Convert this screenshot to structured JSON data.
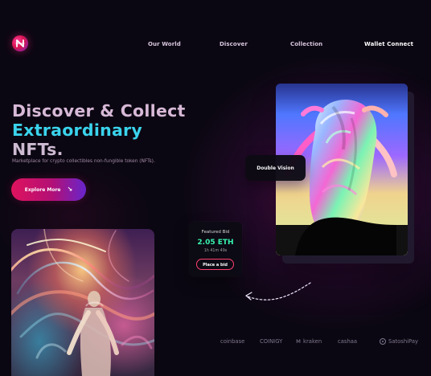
{
  "brand": {
    "logo_icon": "brand-logo-icon"
  },
  "nav": {
    "items": [
      {
        "label": "Our World"
      },
      {
        "label": "Discover"
      },
      {
        "label": "Collection"
      },
      {
        "label": "Wallet Connect"
      }
    ]
  },
  "hero": {
    "title_line_1": "Discover & Collect",
    "title_line_2": "Extraordinary",
    "title_line_3": "NFTs.",
    "subtitle": "Marketplace for crypto collectibles non-fungible token (NFTs).",
    "cta_label": "Explore More",
    "cta_icon": "arrow-down-right-icon"
  },
  "featured": {
    "label": "Featured Bid",
    "price": "2.05 ETH",
    "timer": "1h 41m 49s",
    "button_label": "Place a bid"
  },
  "artwork": {
    "right_card_label": "Double Vision"
  },
  "partners": {
    "items": [
      {
        "label": "coinbase"
      },
      {
        "label": "COINIGY"
      },
      {
        "label": "kraken",
        "icon": "kraken-icon"
      },
      {
        "label": "cashaa"
      },
      {
        "label": "SatoshiPay",
        "icon": "satoshipay-icon"
      }
    ]
  },
  "colors": {
    "background": "#0b0712",
    "title_pink": "#d7b9d7",
    "title_cyan": "#3ad3ec",
    "accent_pink": "#df135d",
    "accent_purple": "#6825cb",
    "price_green": "#38f3ae"
  }
}
